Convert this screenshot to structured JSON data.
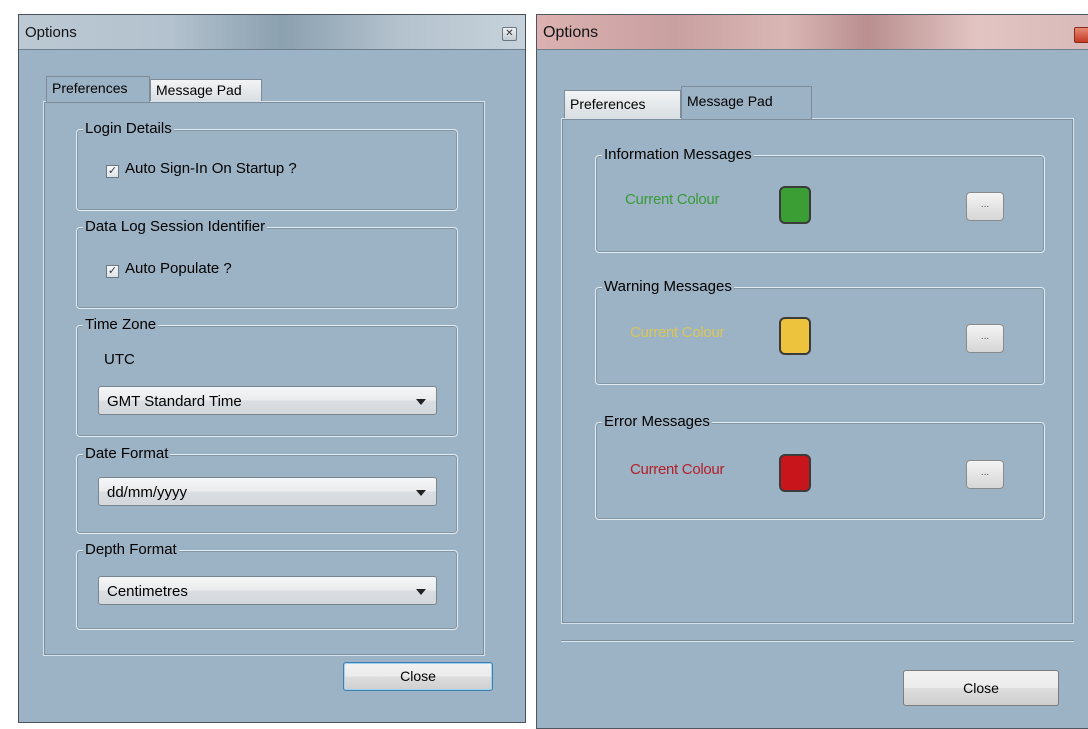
{
  "left_window": {
    "title": "Options",
    "tabs": [
      {
        "label": "Preferences",
        "active": true
      },
      {
        "label": "Message Pad",
        "active": false
      }
    ],
    "login_details": {
      "legend": "Login Details",
      "auto_sign_in_label": "Auto Sign-In On Startup ?",
      "auto_sign_in_checked": true
    },
    "data_log": {
      "legend": "Data Log Session Identifier",
      "auto_populate_label": "Auto Populate ?",
      "auto_populate_checked": true
    },
    "time_zone": {
      "legend": "Time Zone",
      "utc_label": "UTC",
      "selected": "GMT Standard Time"
    },
    "date_format": {
      "legend": "Date Format",
      "selected": "dd/mm/yyyy"
    },
    "depth_format": {
      "legend": "Depth Format",
      "selected": "Centimetres"
    },
    "close_label": "Close"
  },
  "right_window": {
    "title": "Options",
    "tabs": [
      {
        "label": "Preferences",
        "active": false
      },
      {
        "label": "Message Pad",
        "active": true
      }
    ],
    "groups": [
      {
        "legend": "Information Messages",
        "label": "Current Colour",
        "label_color": "#3a9a3a",
        "swatch_color": "#3a9e35"
      },
      {
        "legend": "Warning Messages",
        "label": "Current Colour",
        "label_color": "#d9c65a",
        "swatch_color": "#edc23d"
      },
      {
        "legend": "Error Messages",
        "label": "Current Colour",
        "label_color": "#b3202a",
        "swatch_color": "#c8141b"
      }
    ],
    "dots_label": "...",
    "close_label": "Close"
  },
  "icons": {
    "check": "✓",
    "close": "✕"
  }
}
